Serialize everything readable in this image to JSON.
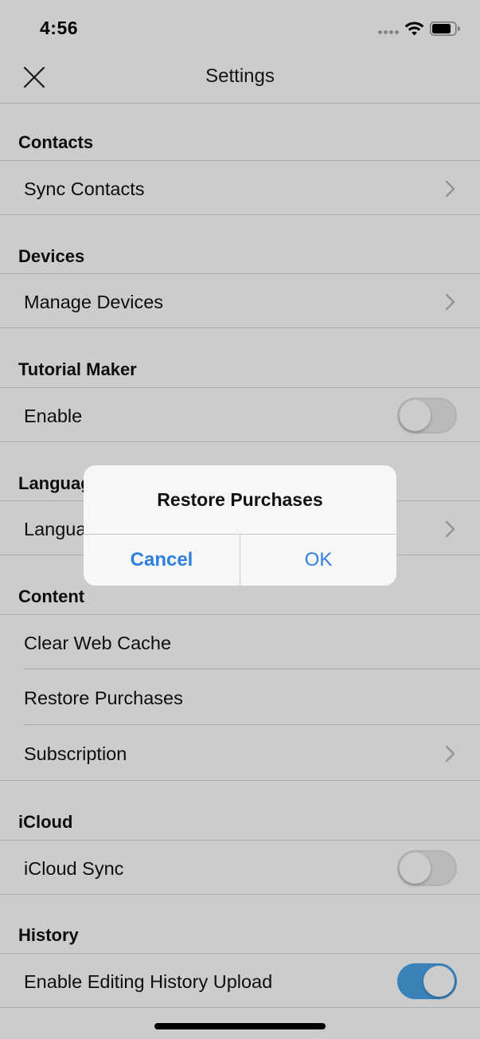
{
  "status_bar": {
    "time": "4:56"
  },
  "nav": {
    "title": "Settings",
    "close_icon": "close-icon"
  },
  "sections": {
    "contacts": {
      "header": "Contacts",
      "sync_contacts": "Sync Contacts"
    },
    "devices": {
      "header": "Devices",
      "manage_devices": "Manage Devices"
    },
    "tutorial_maker": {
      "header": "Tutorial Maker",
      "enable": "Enable",
      "enable_on": false
    },
    "language": {
      "header": "Language",
      "language_row": "Language"
    },
    "content": {
      "header": "Content",
      "clear_web_cache": "Clear Web Cache",
      "restore_purchases": "Restore Purchases",
      "subscription": "Subscription"
    },
    "icloud": {
      "header": "iCloud",
      "icloud_sync": "iCloud Sync",
      "icloud_sync_on": false
    },
    "history": {
      "header": "History",
      "upload": "Enable Editing History Upload",
      "upload_on": true
    }
  },
  "alert": {
    "title": "Restore Purchases",
    "cancel_label": "Cancel",
    "ok_label": "OK"
  },
  "colors": {
    "accent": "#2f7fe0",
    "toggle_on": "#4aa3e8",
    "separator": "#d4d4d6"
  }
}
